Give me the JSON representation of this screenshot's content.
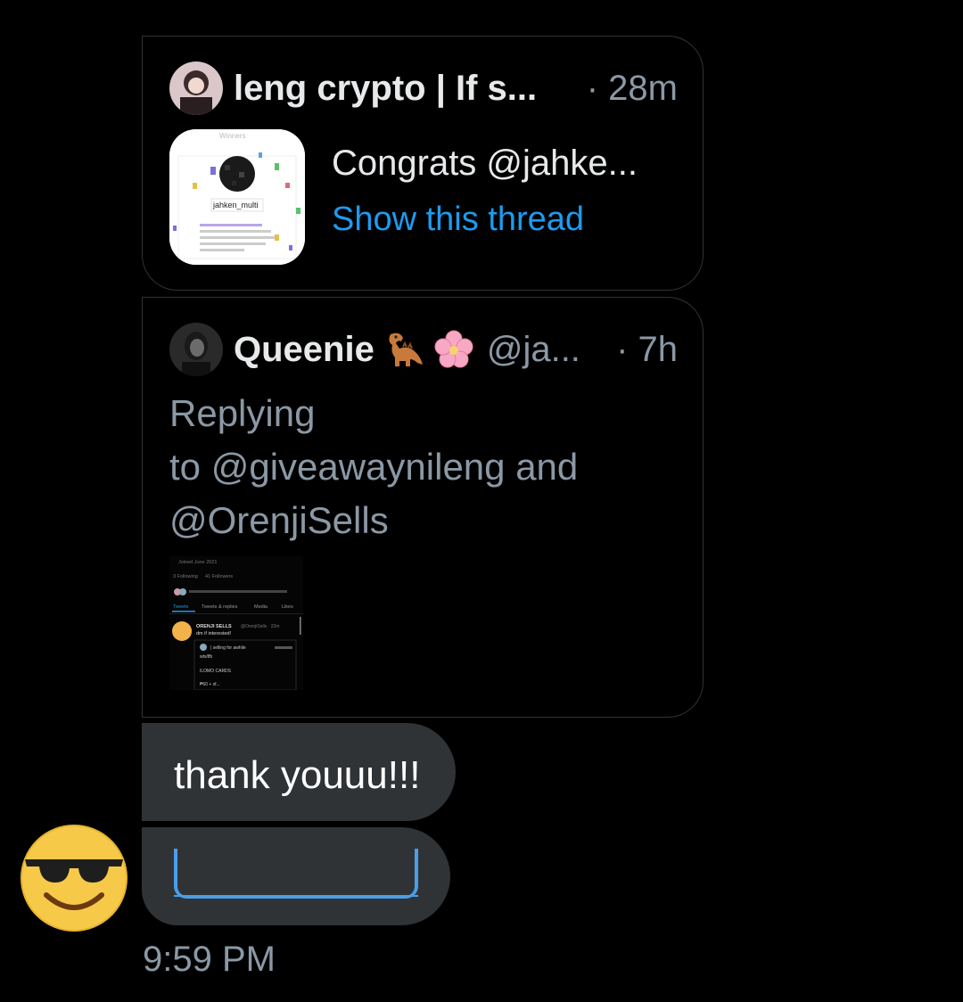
{
  "quoted_tweet_1": {
    "display_name": "leng crypto | If s...",
    "time": "· 28m",
    "text": "Congrats @jahke...",
    "show_thread": "Show this thread",
    "thumbnail": {
      "header": "Winners",
      "username": "jahken_multi"
    }
  },
  "quoted_tweet_2": {
    "display_name": "Queenie",
    "emojis": [
      "dinosaur-emoji",
      "cherry-blossom-emoji"
    ],
    "handle": "@ja...",
    "time": "· 7h",
    "reply_line_1": "Replying",
    "reply_line_2": "to @giveawaynileng and",
    "reply_line_3": "@OrenjiSells",
    "embedded_screenshot": {
      "joined": "Joined June 2021",
      "following": "3 Following",
      "followers": "41 Followers",
      "tabs": [
        "Tweets",
        "Tweets & replies",
        "Media",
        "Likes"
      ],
      "author": "ORENJI SELLS",
      "handle_time": "@OrenjiSells · 22m",
      "tweet": "dm if interested!",
      "quoted_line": "| selling for awhile",
      "quoted_body_1": "wts/lfb",
      "quoted_body_2": "ILOMO CARDS",
      "quoted_body_3": "₱60 + sf..."
    }
  },
  "messages": [
    {
      "text": "thank youuu!!!"
    },
    {
      "type": "link-preview"
    }
  ],
  "sender_avatar": "sunglasses-emoji-avatar",
  "timestamp": "9:59 PM",
  "colors": {
    "background": "#000000",
    "bubble": "#2f3336",
    "link_blue": "#1d9bf0",
    "muted": "#8b98a5"
  }
}
